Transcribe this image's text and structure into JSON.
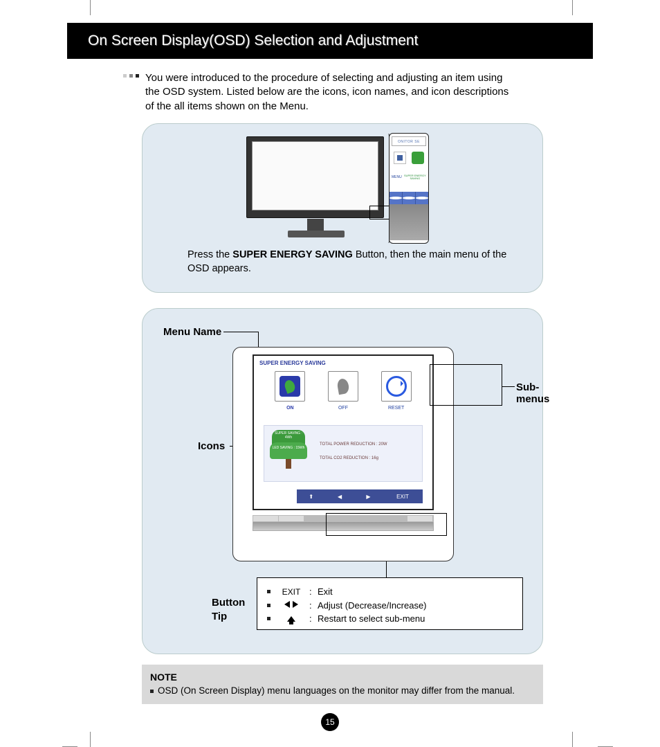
{
  "header": {
    "title": "On Screen Display(OSD) Selection and Adjustment"
  },
  "intro": "You were introduced to the procedure of selecting and adjusting an item using the OSD system. Listed below are the icons, icon names, and icon descriptions of the all items shown on the Menu.",
  "panel1": {
    "text_prefix": "Press the ",
    "text_bold": "SUPER ENERGY SAVING",
    "text_suffix": " Button, then the main menu of the OSD appears.",
    "zoom": {
      "top": "ONITOR SE",
      "menu": "MENU",
      "ses": "SUPER ENERGY SAVING"
    }
  },
  "panel2": {
    "labels": {
      "menu_name": "Menu Name",
      "sub_menus": "Sub-menus",
      "icons": "Icons",
      "button_tip": "Button Tip"
    },
    "osd": {
      "title": "SUPER ENERGY SAVING",
      "icons": {
        "on": "ON",
        "off": "OFF",
        "reset": "RESET"
      },
      "tree": {
        "top": "SUPER SAVING : 4Wh",
        "mid": "LED SAVING : 15Wh"
      },
      "stats": {
        "power": "TOTAL POWER REDUCTION : 20W",
        "co2": "TOTAL CO2 REDUCTION : 16g"
      },
      "nav_exit": "EXIT"
    },
    "tips": {
      "exit_sym": "EXIT",
      "exit_txt": "Exit",
      "arrows_txt": "Adjust (Decrease/Increase)",
      "home_txt": "Restart to select sub-menu"
    }
  },
  "note": {
    "title": "NOTE",
    "text": "OSD (On Screen Display) menu languages on the monitor may differ from the manual."
  },
  "page_number": "15"
}
